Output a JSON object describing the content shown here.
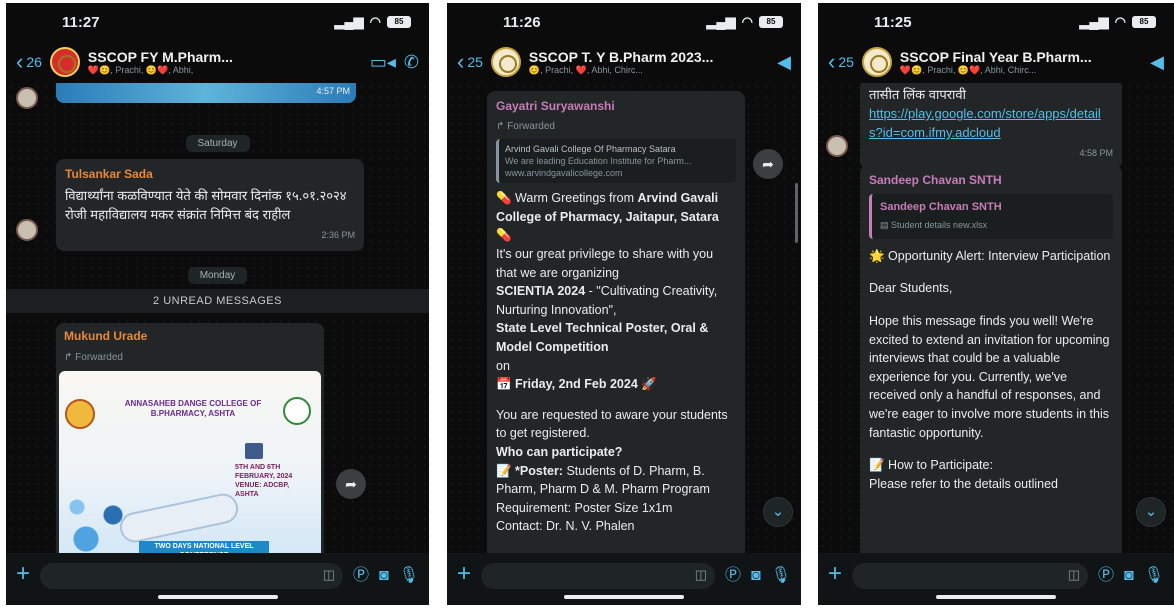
{
  "phones": [
    {
      "time": "11:27",
      "back_count": "26",
      "title": "SSCOP FY M.Pharm...",
      "subtitle": "❤️😊, Prachi, 😊❤️, Abhi,",
      "messages": {
        "date1": "Saturday",
        "sender1": "Tulsankar Sada",
        "text1": "विद्यार्थ्यांना कळविण्यात येते की सोमवार दिनांक १५.०१.२०२४ रोजी महाविद्यालय मकर संक्रांत निमित्त बंद राहील",
        "time1": "2:36 PM",
        "time0": "4:57 PM",
        "date2": "Monday",
        "unread": "2 UNREAD MESSAGES",
        "sender2": "Mukund Urade",
        "forwarded": "Forwarded",
        "poster_title": "ANNASAHEB DANGE COLLEGE OF B.PHARMACY, ASHTA",
        "poster_dates": "5TH AND 6TH FEBRUARY, 2024 VENUE: ADCBP, ASHTA",
        "poster_banner": "TWO DAYS NATIONAL LEVEL CONFERENCE"
      }
    },
    {
      "time": "11:26",
      "back_count": "25",
      "title": "SSCOP T. Y B.Pharm 2023...",
      "subtitle": "😊, Prachi, ❤️, Abhi, Chirc...",
      "messages": {
        "sender": "Gayatri Suryawanshi",
        "forwarded": "Forwarded",
        "link_title": "Arvind Gavali College Of Pharmacy Satara",
        "link_desc": "We are leading Education Institute for Pharm...",
        "link_url": "www.arvindgavalicollege.com",
        "p1a": "💊 Warm Greetings from ",
        "p1b": "Arvind Gavali College of Pharmacy, Jaitapur, Satara",
        "p1c": " 💊",
        "p2": "It's our great privilege to share with you that we are organizing",
        "p3a": "SCIENTIA 2024",
        "p3b": " - \"Cultivating Creativity, Nurturing Innovation\",",
        "p4": "State Level Technical Poster, Oral & Model Competition",
        "p5": "on",
        "p6": "📅 Friday, 2nd Feb 2024 🚀",
        "p7": "You are requested to aware your students to get registered.",
        "p8": "Who can participate?",
        "p9a": "📝 *Poster:",
        "p9b": " Students of D. Pharm, B. Pharm, Pharm D & M. Pharm Program",
        "p10": "Requirement: Poster Size 1x1m",
        "p11": "Contact: Dr. N. V. Phalen"
      }
    },
    {
      "time": "11:25",
      "back_count": "25",
      "title": "SSCOP Final Year B.Pharm...",
      "subtitle": "❤️😊, Prachi, 😊❤️, Abhi, Chirc...",
      "messages": {
        "top_text": "तासीत लिंक वापरावी",
        "top_link": "https://play.google.com/store/apps/details?id=com.ifmy.adcloud",
        "top_time": "4:58 PM",
        "sender": "Sandeep Chavan SNTH",
        "quote_name": "Sandeep Chavan SNTH",
        "quote_text": "Student details new.xlsx",
        "l1": "🌟 Opportunity Alert: Interview Participation",
        "l2": "Dear Students,",
        "l3": "Hope this message finds you well! We're excited to extend an invitation for upcoming interviews that could be a valuable experience for you. Currently, we've received only a handful of responses, and we're eager to involve more students in this fantastic opportunity.",
        "l4": "📝 How to Participate:",
        "l5": "Please refer to the details outlined"
      }
    }
  ],
  "icons": {
    "video": "video-icon",
    "call": "phone-icon",
    "plus": "plus-icon",
    "sticker": "sticker-icon",
    "money": "payment-icon",
    "camera": "camera-icon",
    "mic": "mic-icon"
  },
  "colors": {
    "accent": "#53bdeb",
    "bubble": "#232626",
    "background": "#0b0b0b",
    "sender_orange": "#e8883a",
    "sender_pink": "#c77dba"
  }
}
